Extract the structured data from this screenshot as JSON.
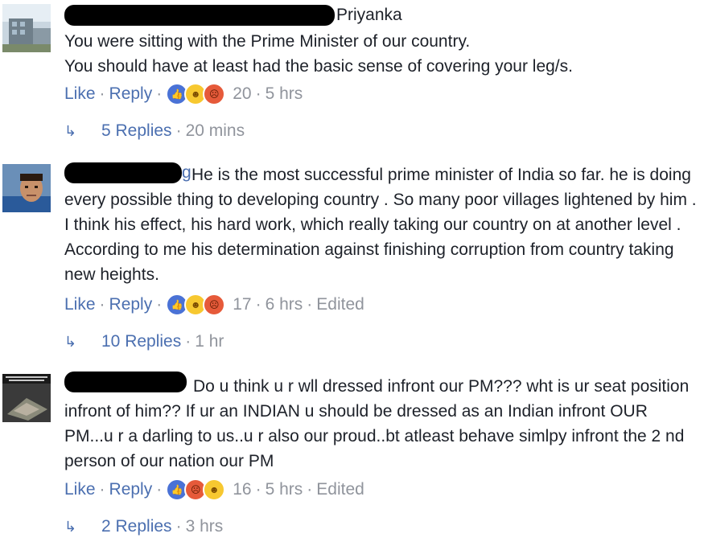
{
  "comments": [
    {
      "author": "Priyanka",
      "text": "You were sitting with the Prime Minister of our country.\nYou should have at least had the basic sense of covering your leg/s.",
      "like_label": "Like",
      "reply_label": "Reply",
      "reaction_count": "20",
      "time": "5 hrs",
      "edited": "",
      "replies_label": "5 Replies",
      "replies_time": "20 mins",
      "reactions": [
        "like-icon",
        "haha-icon",
        "angry-icon"
      ]
    },
    {
      "author": "g",
      "text": "He is the most successful prime minister of India so far. he is doing every possible thing to developing country . So many poor villages lightened by him . I think his effect, his hard work, which really taking our country on at another level . According to me his determination against finishing corruption from country taking new heights.",
      "like_label": "Like",
      "reply_label": "Reply",
      "reaction_count": "17",
      "time": "6 hrs",
      "edited": "Edited",
      "replies_label": "10 Replies",
      "replies_time": "1 hr",
      "reactions": [
        "like-icon",
        "haha-icon",
        "angry-icon"
      ]
    },
    {
      "author": "",
      "text": "Do u think u r wll dressed infront our PM??? wht is ur seat position infront of him?? If ur an INDIAN u should be dressed as an Indian infront OUR PM...u r a darling to us..u r also our proud..bt atleast behave simlpy infront the 2 nd person of our nation our PM",
      "like_label": "Like",
      "reply_label": "Reply",
      "reaction_count": "16",
      "time": "5 hrs",
      "edited": "Edited",
      "replies_label": "2 Replies",
      "replies_time": "3 hrs",
      "reactions": [
        "like-icon",
        "angry-icon",
        "haha-icon"
      ]
    }
  ],
  "colors": {
    "link": "#4b6fb0",
    "meta": "#90949c",
    "text": "#1d2129"
  }
}
